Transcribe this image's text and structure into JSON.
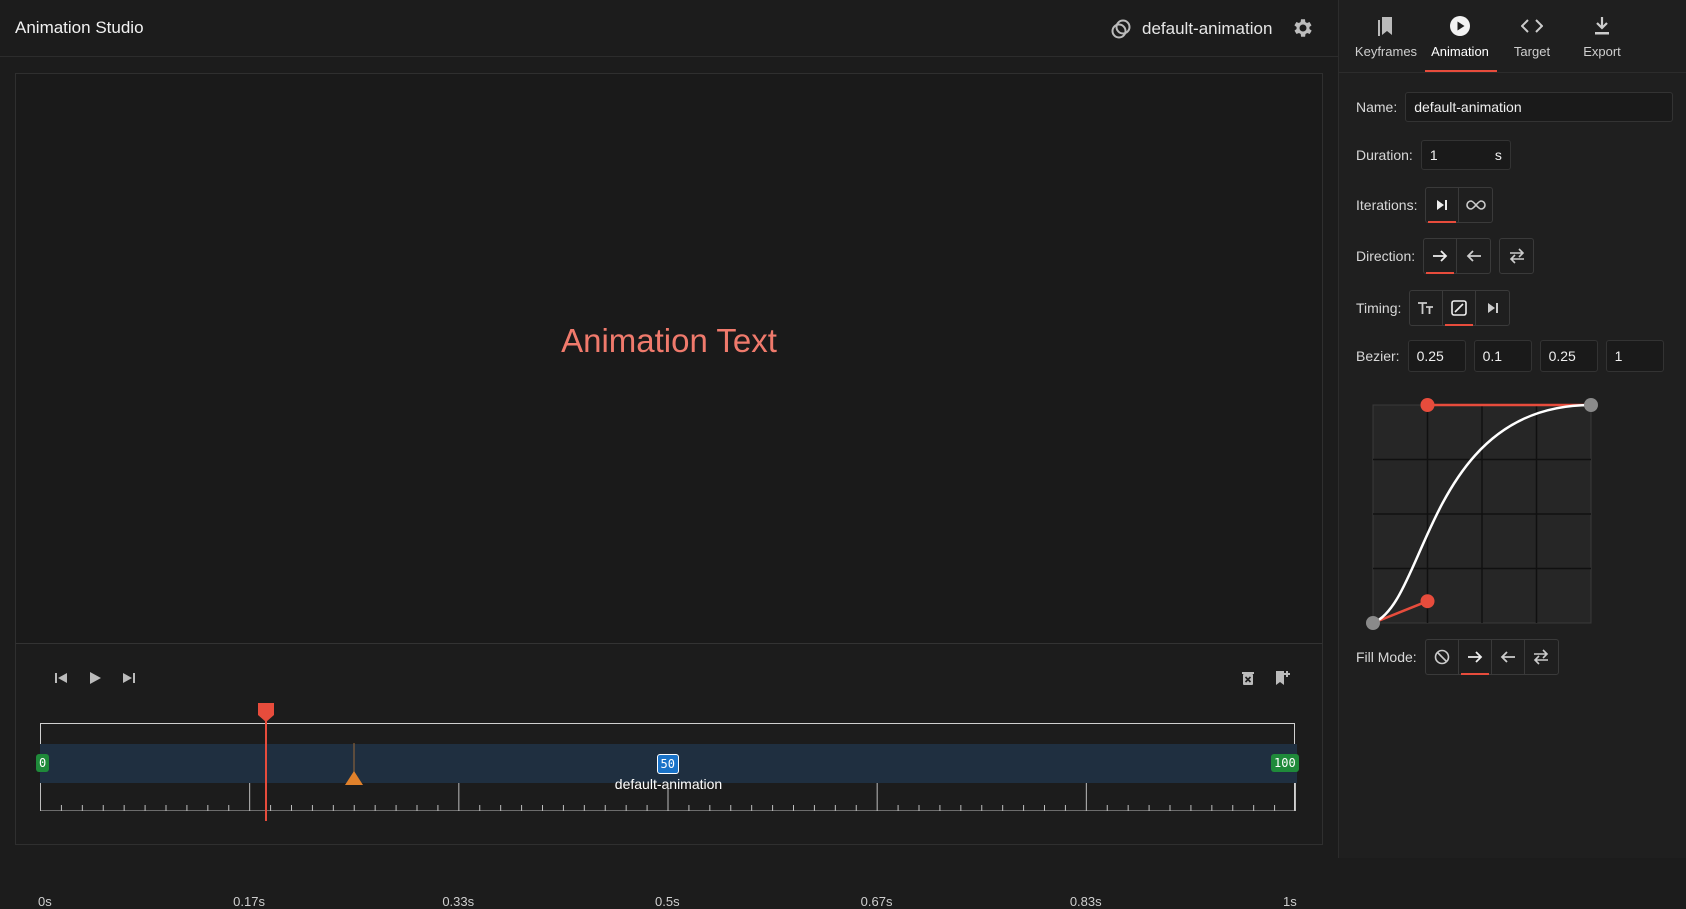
{
  "header": {
    "app_title": "Animation Studio",
    "animation_name": "default-animation"
  },
  "stage": {
    "text": "Animation Text",
    "text_color": "#f07a6c"
  },
  "timeline": {
    "track_label": "default-animation",
    "keyframes": [
      {
        "label": "0",
        "color": "#1f8a3a"
      },
      {
        "label": "50",
        "color": "#1a73c8"
      },
      {
        "label": "100",
        "color": "#1f8a3a"
      }
    ],
    "playhead_time_s": 0.18,
    "marker_time_s": 0.25,
    "tick_labels": [
      "0s",
      "0.17s",
      "0.33s",
      "0.5s",
      "0.67s",
      "0.83s",
      "1s"
    ]
  },
  "panel": {
    "tabs": [
      {
        "label": "Keyframes",
        "icon": "bookmarks-icon"
      },
      {
        "label": "Animation",
        "icon": "play-circle-icon",
        "active": true
      },
      {
        "label": "Target",
        "icon": "code-icon"
      },
      {
        "label": "Export",
        "icon": "download-icon"
      }
    ],
    "name_label": "Name:",
    "name_value": "default-animation",
    "duration_label": "Duration:",
    "duration_value": "1",
    "duration_unit": "s",
    "iterations_label": "Iterations:",
    "direction_label": "Direction:",
    "timing_label": "Timing:",
    "bezier_label": "Bezier:",
    "bezier_values": [
      "0.25",
      "0.1",
      "0.25",
      "1"
    ],
    "fill_mode_label": "Fill Mode:"
  },
  "colors": {
    "accent": "#e74c3c",
    "keyframe_green": "#1f8a3a",
    "keyframe_blue": "#1a73c8",
    "marker_orange": "#e0812b"
  }
}
